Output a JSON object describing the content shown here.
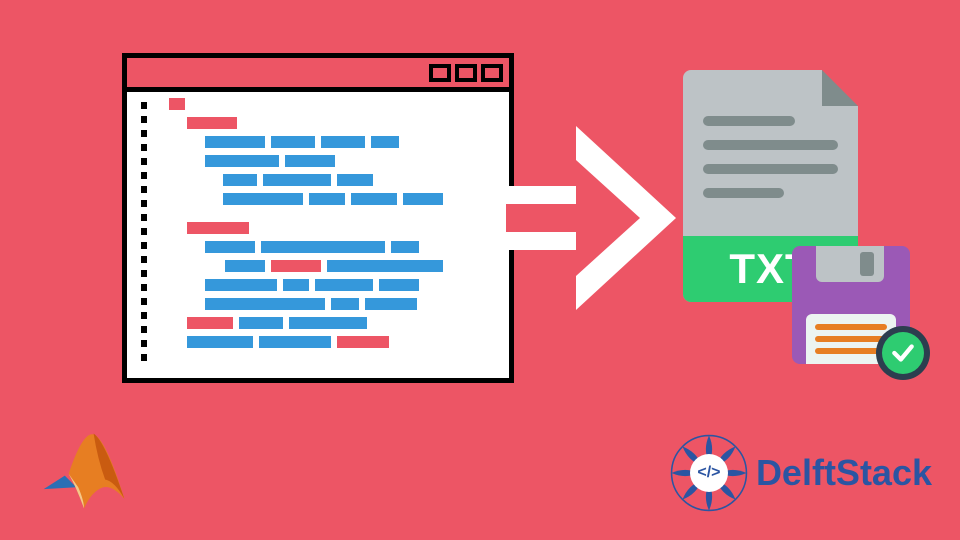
{
  "background_color": "#ed5565",
  "code_window": {
    "blue": "#3598db",
    "red": "#ed5565"
  },
  "txt_doc": {
    "label": "TXT",
    "band_color": "#2ecc71"
  },
  "floppy": {
    "body_color": "#9b59b6"
  },
  "check_badge": {
    "glyph": "✓"
  },
  "brand": {
    "name": "DelftStack",
    "badge": "</>"
  }
}
